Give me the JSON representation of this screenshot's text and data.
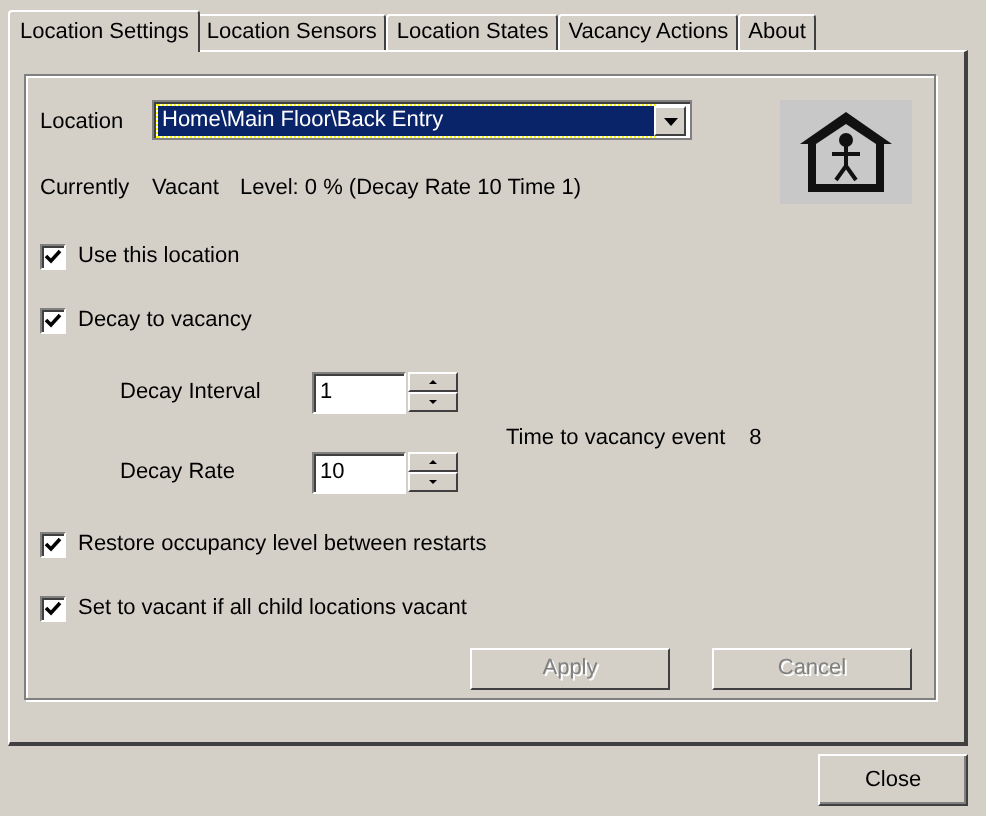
{
  "tabs": [
    {
      "label": "Location Settings",
      "selected": true
    },
    {
      "label": "Location Sensors",
      "selected": false
    },
    {
      "label": "Location States",
      "selected": false
    },
    {
      "label": "Vacancy Actions",
      "selected": false
    },
    {
      "label": "About",
      "selected": false
    }
  ],
  "location": {
    "label": "Location",
    "value": "Home\\Main Floor\\Back Entry"
  },
  "status": {
    "label": "Currently",
    "state": "Vacant",
    "level_text": "Level: 0 % (Decay Rate 10 Time 1)"
  },
  "items": [
    {
      "kind": "checkbox",
      "label": "Use this location",
      "checked": true
    },
    {
      "kind": "checkbox",
      "label": "Decay to vacancy",
      "checked": true
    },
    {
      "kind": "decay",
      "fields": [
        {
          "label": "Decay Interval",
          "value": "1"
        },
        {
          "label": "Decay Rate",
          "value": "10"
        }
      ],
      "time_label": "Time to vacancy event",
      "time_value": "8"
    },
    {
      "kind": "checkbox",
      "label": "Restore occupancy level between restarts",
      "checked": true
    },
    {
      "kind": "checkbox",
      "label": "Set to vacant if all child locations vacant",
      "checked": true
    }
  ],
  "buttons": [
    {
      "label": "Apply",
      "disabled": true
    },
    {
      "label": "Cancel",
      "disabled": true
    }
  ],
  "close_button": {
    "label": "Close"
  }
}
